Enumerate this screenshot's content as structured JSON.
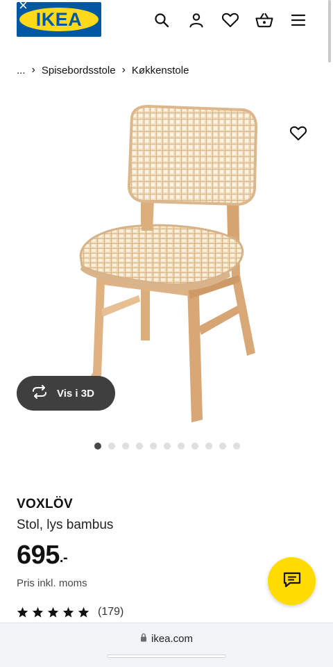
{
  "header": {
    "logo_text": "IKEA",
    "close_symbol": "×",
    "icons": [
      "search-icon",
      "user-icon",
      "heart-icon",
      "basket-icon",
      "menu-icon"
    ]
  },
  "breadcrumb": {
    "ellipsis": "...",
    "items": [
      "Spisebordsstole",
      "Køkkenstole"
    ]
  },
  "gallery": {
    "view_3d_label": "Vis i 3D",
    "slide_count": 11,
    "active_slide": 1
  },
  "product": {
    "name": "VOXLÖV",
    "description": "Stol, lys bambus",
    "price": "695",
    "price_suffix": ".-",
    "price_note": "Pris inkl. moms",
    "rating_stars": 5,
    "rating_count": "(179)"
  },
  "browser": {
    "url": "ikea.com"
  },
  "colors": {
    "brand_blue": "#0058a3",
    "brand_yellow": "#ffda1a",
    "chat_yellow": "#ffdb00",
    "dark_pill": "#3f3f3f"
  }
}
